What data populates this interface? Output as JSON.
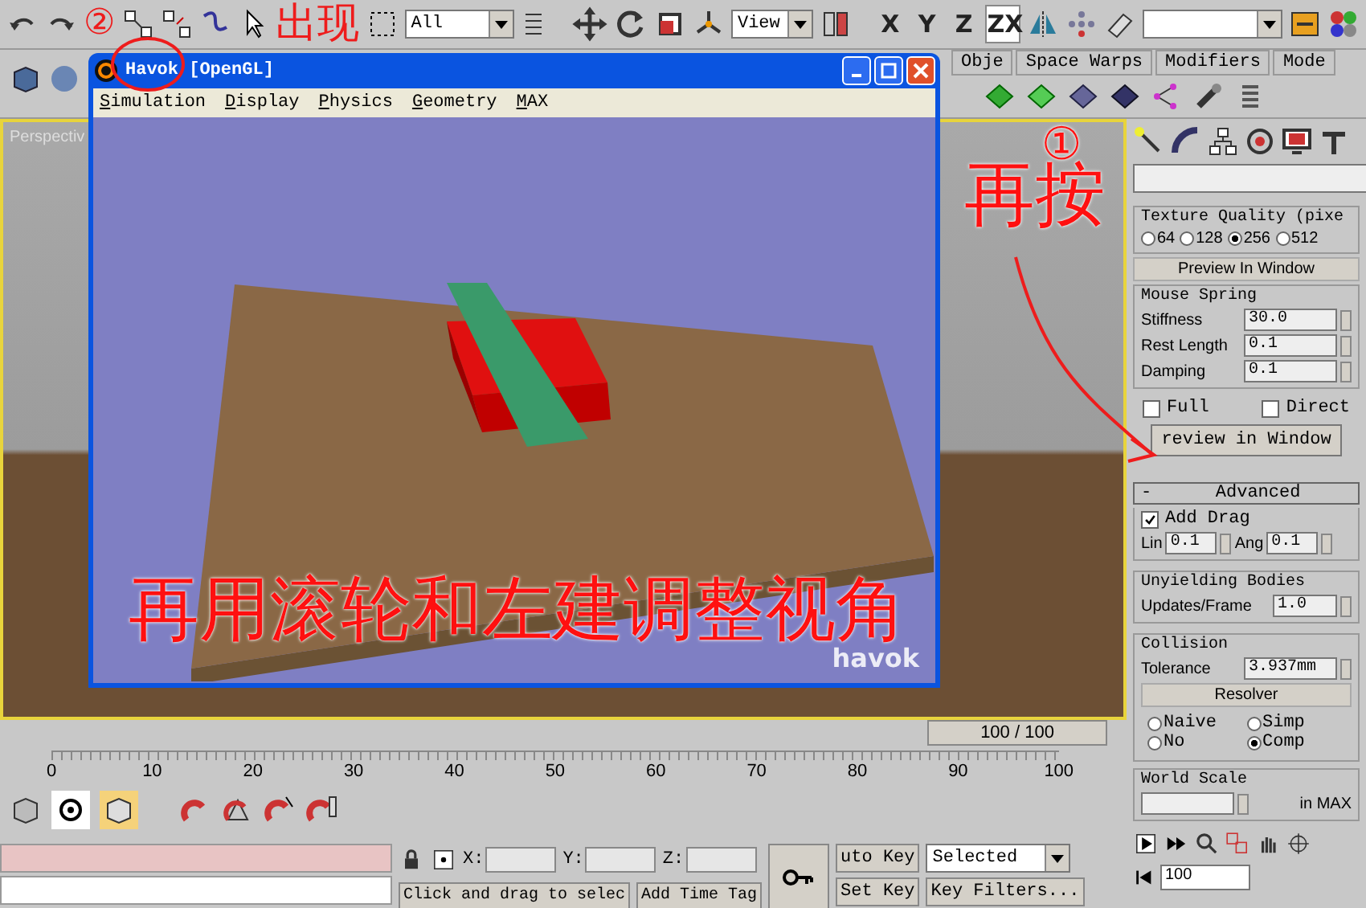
{
  "toolbar": {
    "selection_filter": "All",
    "reference_coord": "View",
    "axis_buttons": [
      {
        "label": "X",
        "selected": false
      },
      {
        "label": "Y",
        "selected": false
      },
      {
        "label": "Z",
        "selected": false
      },
      {
        "label": "ZX",
        "selected": true
      }
    ]
  },
  "panel_tabs": [
    {
      "label": "Obje"
    },
    {
      "label": "Space Warps"
    },
    {
      "label": "Modifiers"
    },
    {
      "label": "Mode"
    }
  ],
  "viewport": {
    "label": "Perspectiv"
  },
  "havok_window": {
    "title": "Havok [OpenGL]",
    "menu": [
      "Simulation",
      "Display",
      "Physics",
      "Geometry",
      "MAX"
    ],
    "logo": "havok"
  },
  "command_panel": {
    "texture_quality": {
      "title": "Texture Quality (pixe",
      "options": [
        {
          "label": "64",
          "selected": false
        },
        {
          "label": "128",
          "selected": false
        },
        {
          "label": "256",
          "selected": true
        },
        {
          "label": "512",
          "selected": false
        }
      ]
    },
    "preview_header": "Preview In Window",
    "mouse_spring": {
      "title": "Mouse Spring",
      "fields": [
        {
          "label": "Stiffness",
          "value": "30.0"
        },
        {
          "label": "Rest Length",
          "value": "0.1"
        },
        {
          "label": "Damping",
          "value": "0.1"
        }
      ]
    },
    "checkboxes": [
      {
        "label": "Full",
        "checked": false
      },
      {
        "label": "Direct",
        "checked": false
      }
    ],
    "preview_button": "review in Window",
    "advanced": {
      "toggle": "-",
      "title": "Advanced"
    },
    "add_drag": {
      "label": "Add Drag",
      "checked": true
    },
    "drag_fields": [
      {
        "label": "Lin",
        "value": "0.1"
      },
      {
        "label": "Ang",
        "value": "0.1"
      }
    ],
    "unyielding": {
      "title": "Unyielding Bodies",
      "label": "Updates/Frame",
      "value": "1.0"
    },
    "collision": {
      "title": "Collision",
      "label": "Tolerance",
      "value": "3.937mm",
      "resolver": "Resolver",
      "options": [
        {
          "label": "Naive",
          "selected": false
        },
        {
          "label": "Simp",
          "selected": false
        },
        {
          "label": "No",
          "selected": false
        },
        {
          "label": "Comp",
          "selected": true
        }
      ]
    },
    "world_scale": {
      "title": "World Scale",
      "unit": "in MAX"
    }
  },
  "timeline": {
    "frame": "100 / 100",
    "level": 1.0,
    "ticks": [
      "0",
      "10",
      "20",
      "30",
      "40",
      "50",
      "60",
      "70",
      "80",
      "90",
      "100"
    ]
  },
  "status": {
    "coords": [
      "X:",
      "Y:",
      "Z:"
    ],
    "prompt": "Click and drag to selec",
    "add_time_tag": "Add Time Tag",
    "auto_key": "uto Key",
    "key_mode": "Selected",
    "set_key": "Set Key",
    "key_filters": "Key Filters...",
    "frame_field": "100"
  },
  "annotations": [
    {
      "text": "②"
    },
    {
      "text": "出现"
    },
    {
      "text": "①"
    },
    {
      "text": "再按"
    },
    {
      "text": "再用滚轮和左建调整视角"
    }
  ]
}
